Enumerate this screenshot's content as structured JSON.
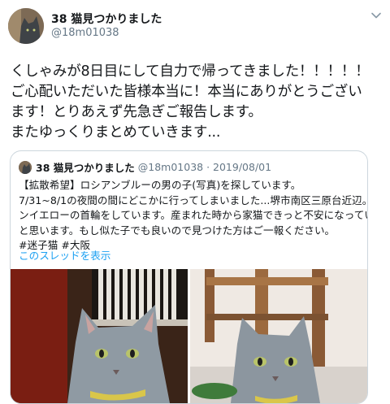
{
  "tweet": {
    "author_name": "38 猫見つかりました",
    "author_handle": "@18m01038",
    "body_lines": [
      "くしゃみが8日目にして自力で帰ってきました！！！！！",
      "ご心配いただいた皆様本当に！本当にありがとうござい",
      "ます！とりあえず先急ぎご報告します。",
      "またゆっくりまとめていきます..."
    ]
  },
  "quoted": {
    "author_name": "38 猫見つかりました",
    "meta": "@18m01038 · 2019/08/01",
    "lines": [
      "【拡散希望】ロシアンブルーの男の子(写真)を探しています。",
      "7/31~8/1の夜間の間にどこかに行ってしまいました...堺市南区三原台近辺。レモ",
      "ンイエローの首輪をしています。産まれた時から家猫できっと不安になっている",
      "と思います。もし似た子でも良いので見つけた方はご一報ください。",
      "#迷子猫 #大阪"
    ],
    "thread_link": "このスレッドを表示"
  },
  "colors": {
    "text": "#14171a",
    "secondary": "#657786",
    "link": "#1da1f2",
    "border": "#ccd6dd"
  },
  "icons": [
    "avatar",
    "chevron-down-icon"
  ]
}
